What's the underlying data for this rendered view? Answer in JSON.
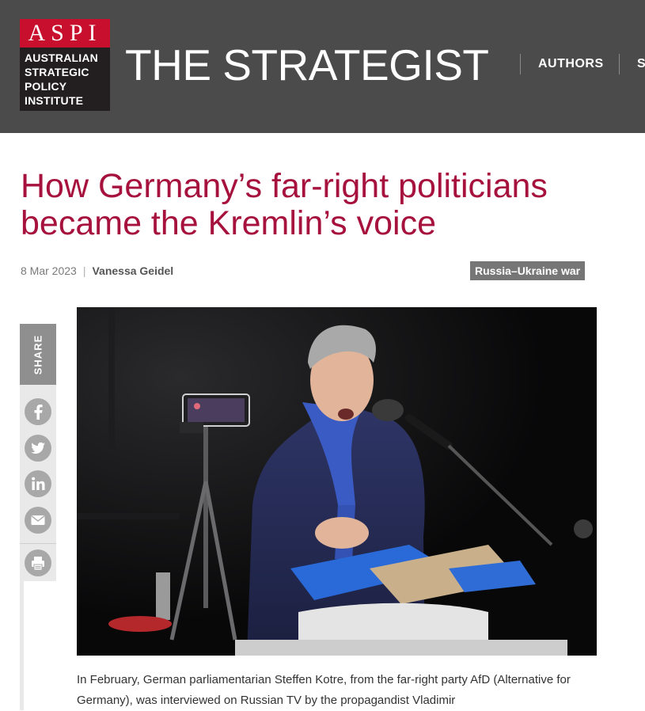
{
  "header": {
    "logo_acronym": "ASPI",
    "logo_lines": [
      "AUSTRALIAN",
      "STRATEGIC",
      "POLICY",
      "INSTITUTE"
    ],
    "site_title": "THE STRATEGIST",
    "nav": [
      {
        "label": "AUTHORS"
      },
      {
        "label": "S"
      }
    ]
  },
  "article": {
    "title": "How Germany’s far-right politicians became the Kremlin’s voice",
    "date": "8 Mar 2023",
    "separator": "|",
    "author": "Vanessa Geidel",
    "category": "Russia–Ukraine war",
    "body_excerpt": "In February, German parliamentarian Steffen Kotre, from the far-right party AfD (Alternative for Germany), was interviewed on Russian TV by the propagandist Vladimir"
  },
  "share": {
    "label": "SHARE",
    "buttons": [
      {
        "icon": "facebook-icon"
      },
      {
        "icon": "twitter-icon"
      },
      {
        "icon": "linkedin-icon"
      },
      {
        "icon": "email-icon"
      },
      {
        "icon": "print-icon"
      }
    ]
  },
  "colors": {
    "header_bg": "#4b4b4b",
    "brand_red": "#c8102e",
    "headline": "#a6123d",
    "tag_bg": "#767676",
    "share_bg": "#8f8f8f"
  }
}
